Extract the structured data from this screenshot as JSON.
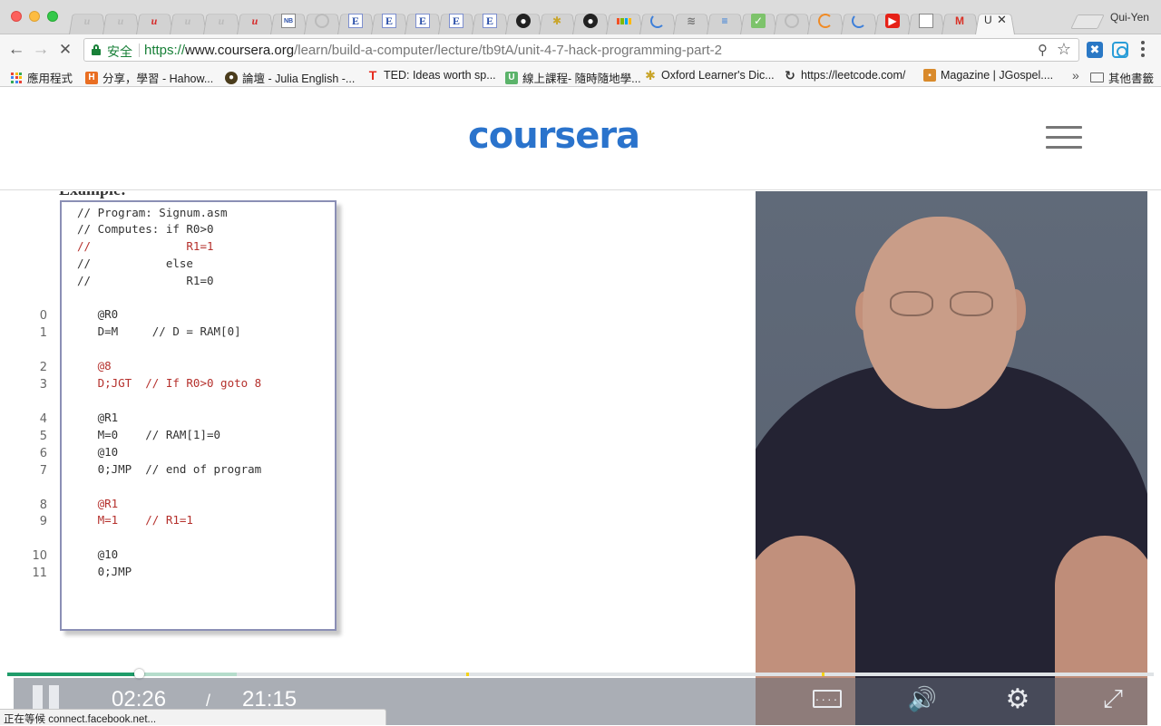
{
  "browser": {
    "profile_name": "Qui-Yen",
    "active_tab_label": "U",
    "address": {
      "secure_label": "安全",
      "url_scheme": "https://",
      "url_host": "www.coursera.org",
      "url_path": "/learn/build-a-computer/lecture/tb9tA/unit-4-7-hack-programming-part-2"
    },
    "tabs": [
      {
        "icon": "udemy-gray-icon",
        "glyph": "u"
      },
      {
        "icon": "udemy-gray-icon",
        "glyph": "u"
      },
      {
        "icon": "udemy-red-icon",
        "glyph": "u"
      },
      {
        "icon": "udemy-gray-icon",
        "glyph": "u"
      },
      {
        "icon": "udemy-gray-icon",
        "glyph": "u"
      },
      {
        "icon": "udemy-red-icon",
        "glyph": "u"
      },
      {
        "icon": "document-icon",
        "glyph": "NB"
      },
      {
        "icon": "loading-circle-icon",
        "glyph": ""
      },
      {
        "icon": "e-letter-icon",
        "glyph": "E"
      },
      {
        "icon": "e-letter-icon",
        "glyph": "E"
      },
      {
        "icon": "e-letter-icon",
        "glyph": "E"
      },
      {
        "icon": "e-letter-icon",
        "glyph": "E"
      },
      {
        "icon": "e-letter-icon",
        "glyph": "E"
      },
      {
        "icon": "github-icon",
        "glyph": "●"
      },
      {
        "icon": "yelp-icon",
        "glyph": "✱"
      },
      {
        "icon": "github-icon",
        "glyph": "●"
      },
      {
        "icon": "microsoft-icon",
        "glyph": ""
      },
      {
        "icon": "blue-arc-icon",
        "glyph": ""
      },
      {
        "icon": "stack-icon",
        "glyph": "≋"
      },
      {
        "icon": "funnel-icon",
        "glyph": "≡"
      },
      {
        "icon": "green-check-icon",
        "glyph": "✓"
      },
      {
        "icon": "loading-circle-icon",
        "glyph": ""
      },
      {
        "icon": "orange-arc-icon",
        "glyph": ""
      },
      {
        "icon": "blue-arc-icon",
        "glyph": ""
      },
      {
        "icon": "youtube-icon",
        "glyph": "▶"
      },
      {
        "icon": "document-icon",
        "glyph": ""
      },
      {
        "icon": "gmail-icon",
        "glyph": "M"
      }
    ],
    "bookmarks": [
      {
        "label": "應用程式",
        "icon": "apps-grid-icon"
      },
      {
        "label": "分享，學習 - Hahow...",
        "icon": "hahow-icon",
        "glyph": "H",
        "color": "#e96e22"
      },
      {
        "label": "論壇 - Julia English -...",
        "icon": "julia-icon",
        "glyph": "●",
        "color": "#4a3c1c"
      },
      {
        "label": "TED: Ideas worth sp...",
        "icon": "ted-icon",
        "glyph": "T",
        "color": "#e62b1e"
      },
      {
        "label": "線上課程- 隨時隨地學...",
        "icon": "u-course-icon",
        "glyph": "U",
        "color": "#5bb36a"
      },
      {
        "label": "Oxford Learner's Dic...",
        "icon": "oxford-icon",
        "glyph": "✱",
        "color": "#c9a52a"
      },
      {
        "label": "https://leetcode.com/",
        "icon": "leetcode-icon",
        "glyph": "↻",
        "color": "#333333"
      },
      {
        "label": "Magazine | JGospel....",
        "icon": "jgospel-icon",
        "glyph": "▪",
        "color": "#d98a2b"
      }
    ],
    "other_bookmarks_label": "其他書籤",
    "status_text": "正在等候 connect.facebook.net..."
  },
  "site": {
    "logo_text": "coursera"
  },
  "lecture_slide": {
    "heading": "Example:",
    "code_lines": [
      {
        "text": "// Program: Signum.asm",
        "red": false
      },
      {
        "text": "// Computes: if R0>0",
        "red": false
      },
      {
        "text": "//              R1=1",
        "red": true
      },
      {
        "text": "//           else",
        "red": false
      },
      {
        "text": "//              R1=0",
        "red": false
      },
      {
        "text": "   @R0",
        "red": false,
        "n": "0"
      },
      {
        "text": "   D=M     // D = RAM[0]",
        "red": false,
        "n": "1"
      },
      {
        "text": "   @8",
        "red": true,
        "n": "2"
      },
      {
        "text": "   D;JGT  // If R0>0 goto 8",
        "red": true,
        "n": "3"
      },
      {
        "text": "   @R1",
        "red": false,
        "n": "4"
      },
      {
        "text": "   M=0    // RAM[1]=0",
        "red": false,
        "n": "5"
      },
      {
        "text": "   @10",
        "red": false,
        "n": "6"
      },
      {
        "text": "   0;JMP  // end of program",
        "red": false,
        "n": "7"
      },
      {
        "text": "   @R1",
        "red": true,
        "n": "8"
      },
      {
        "text": "   M=1    // R1=1",
        "red": true,
        "n": "9"
      },
      {
        "text": "   @10",
        "red": false,
        "n": "10"
      },
      {
        "text": "   0;JMP",
        "red": false,
        "n": "11"
      }
    ]
  },
  "player": {
    "current_time": "02:26",
    "separator": "/",
    "duration": "21:15",
    "played_fraction": 0.115,
    "buffered_fraction": 0.2,
    "colors": {
      "played": "#1f9c6a",
      "buffered": "#b5dccb",
      "marker": "#f5d317"
    }
  }
}
